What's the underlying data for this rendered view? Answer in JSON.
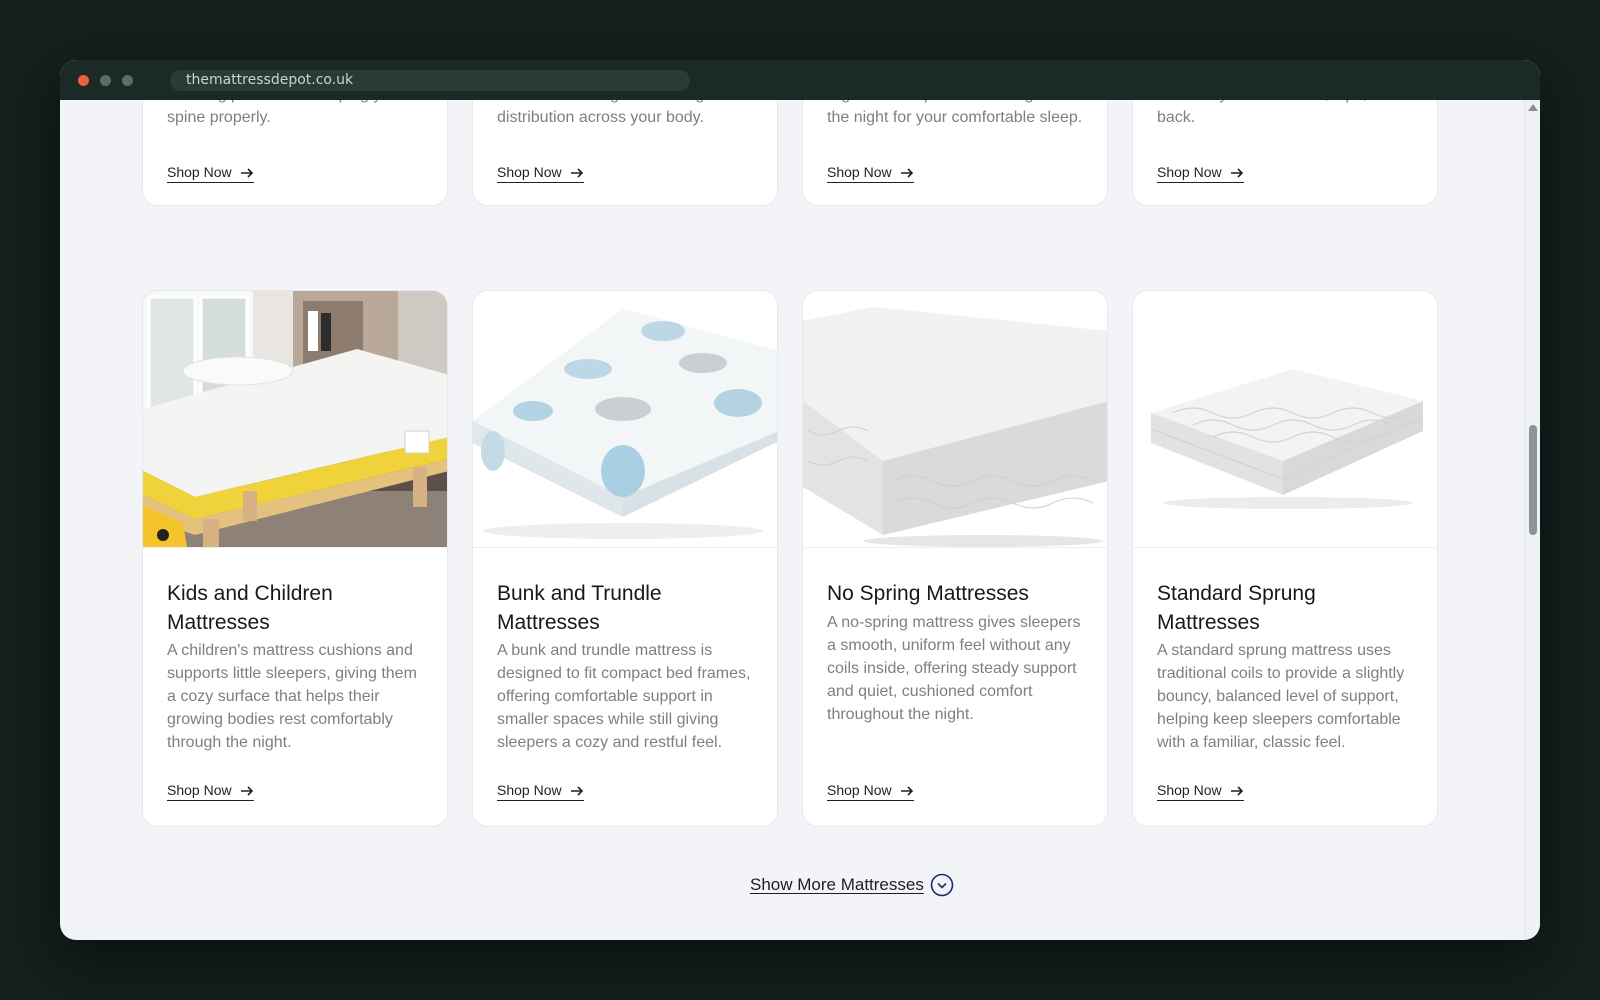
{
  "browser": {
    "url": "themattressdepot.co.uk"
  },
  "top_row": [
    {
      "description_visible": "relieving pressure & keeping your spine properly.",
      "shop_label": "Shop Now"
    },
    {
      "description_visible": "circulation through even weight distribution across your body.",
      "shop_label": "Shop Now"
    },
    {
      "description_visible": "regulates temperature throughout the night for your comfortable sleep.",
      "shop_label": "Shop Now"
    },
    {
      "description_visible": "relief for your shoulders, hips, and back.",
      "shop_label": "Shop Now"
    }
  ],
  "products": [
    {
      "title": "Kids and Children Mattresses",
      "description": "A children's mattress cushions and supports little sleepers, giving them a cozy surface that helps their growing bodies rest comfortably through the night.",
      "shop_label": "Shop Now"
    },
    {
      "title": "Bunk and Trundle Mattresses",
      "description": "A bunk and trundle mattress is designed to fit compact bed frames, offering comfortable support in smaller spaces while still giving sleepers a cozy and restful feel.",
      "shop_label": "Shop Now"
    },
    {
      "title": "No Spring Mattresses",
      "description": "A no-spring mattress gives sleepers a smooth, uniform feel without any coils inside, offering steady support and quiet, cushioned comfort throughout the night.",
      "shop_label": "Shop Now"
    },
    {
      "title": "Standard Sprung Mattresses",
      "description": "A standard sprung mattress uses traditional coils to provide a slightly bouncy, balanced level of support, helping keep sleepers comfortable with a familiar, classic feel.",
      "shop_label": "Shop Now"
    }
  ],
  "show_more": {
    "label": "Show More Mattresses"
  },
  "colors": {
    "background": "#13201e",
    "page": "#f3f4f8",
    "accent": "#1e2a6e",
    "close_dot": "#e8643c"
  },
  "icons": {
    "shop_arrow": "arrow-right-icon",
    "show_more": "chevron-down-circle-icon"
  }
}
